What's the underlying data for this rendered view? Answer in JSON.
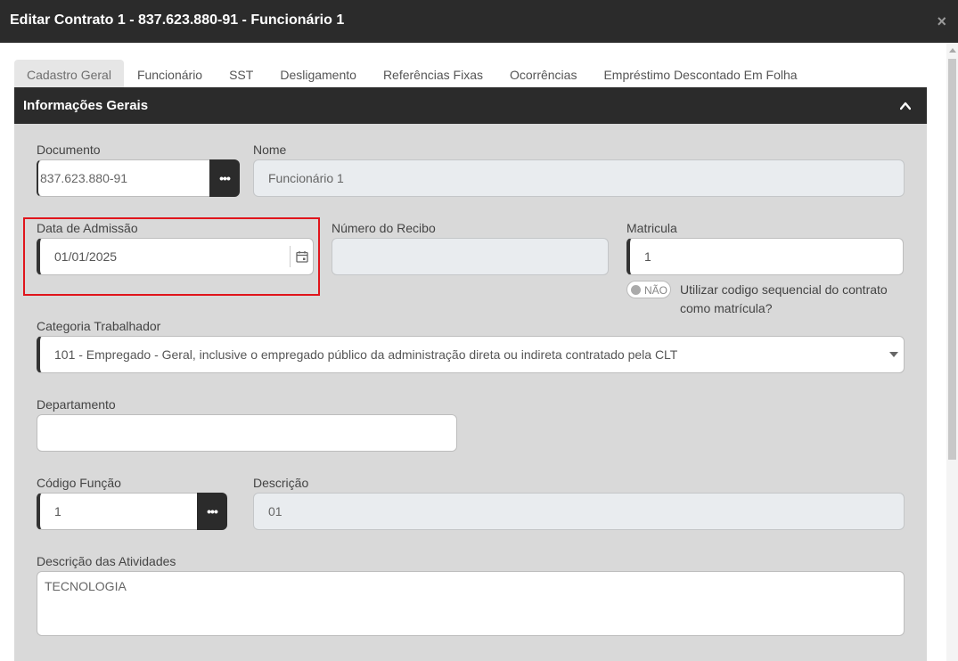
{
  "window": {
    "title": "Editar Contrato 1 - 837.623.880-91 - Funcionário 1",
    "close_glyph": "×"
  },
  "tabs": [
    {
      "label": "Cadastro Geral",
      "active": true
    },
    {
      "label": "Funcionário"
    },
    {
      "label": "SST"
    },
    {
      "label": "Desligamento"
    },
    {
      "label": "Referências Fixas"
    },
    {
      "label": "Ocorrências"
    },
    {
      "label": "Empréstimo Descontado Em Folha"
    }
  ],
  "section": {
    "title": "Informações Gerais",
    "collapse_icon": "chevron-up-icon"
  },
  "form": {
    "documento": {
      "label": "Documento",
      "value": "837.623.880-91",
      "button_glyph": "•••"
    },
    "nome": {
      "label": "Nome",
      "value": "Funcionário 1"
    },
    "data_admissao": {
      "label": "Data de Admissão",
      "value": "01/01/2025",
      "icon": "calendar-icon"
    },
    "numero_recibo": {
      "label": "Número do Recibo",
      "value": ""
    },
    "matricula": {
      "label": "Matricula",
      "value": "1"
    },
    "sequencial": {
      "toggle_text": "NÃO",
      "label": "Utilizar codigo sequencial do contrato como matrícula?",
      "checked": false
    },
    "categoria": {
      "label": "Categoria Trabalhador",
      "value": "101 - Empregado - Geral, inclusive o empregado público da administração direta ou indireta contratado pela CLT"
    },
    "departamento": {
      "label": "Departamento",
      "value": ""
    },
    "codigo_funcao": {
      "label": "Código Função",
      "value": "1",
      "button_glyph": "•••"
    },
    "descricao": {
      "label": "Descrição",
      "value": "01"
    },
    "descricao_atividades": {
      "label": "Descrição das Atividades",
      "value": "TECNOLOGIA"
    }
  },
  "colors": {
    "header_bg": "#2b2b2b",
    "panel_bg": "#d9d9d9",
    "highlight": "#e0151c"
  }
}
